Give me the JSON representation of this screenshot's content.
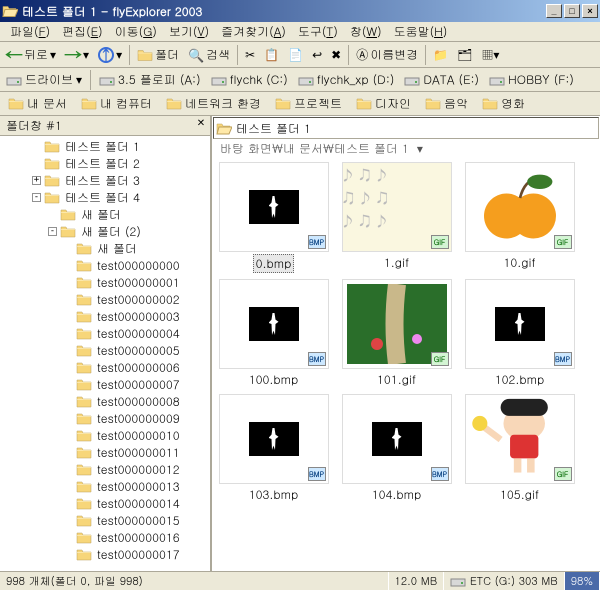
{
  "title": "테스트 폴더 1 - flyExplorer 2003",
  "menu": [
    "파일(F)",
    "편집(E)",
    "이동(G)",
    "보기(V)",
    "즐겨찾기(A)",
    "도구(T)",
    "창(W)",
    "도움말(H)"
  ],
  "tb": {
    "back": "뒤로",
    "folder": "폴더",
    "search": "검색",
    "rename": "이름변경"
  },
  "drives": {
    "label": "드라이브",
    "items": [
      "3.5 플로피 (A:)",
      "flychk (C:)",
      "flychk_xp (D:)",
      "DATA (E:)",
      "HOBBY (F:)"
    ]
  },
  "bookmarks": [
    "내 문서",
    "내 컴퓨터",
    "네트워크 환경",
    "프로젝트",
    "디자인",
    "음악",
    "영화"
  ],
  "treeHeader": "폴더창 #1",
  "tree": [
    {
      "d": 2,
      "e": "",
      "n": "테스트 폴더 1"
    },
    {
      "d": 2,
      "e": "",
      "n": "테스트 폴더 2"
    },
    {
      "d": 2,
      "e": "+",
      "n": "테스트 폴더 3"
    },
    {
      "d": 2,
      "e": "-",
      "n": "테스트 폴더 4"
    },
    {
      "d": 3,
      "e": "",
      "n": "새 폴더"
    },
    {
      "d": 3,
      "e": "-",
      "n": "새 폴더 (2)"
    },
    {
      "d": 4,
      "e": "",
      "n": "새 폴더"
    },
    {
      "d": 4,
      "e": "",
      "n": "test000000000"
    },
    {
      "d": 4,
      "e": "",
      "n": "test000000001"
    },
    {
      "d": 4,
      "e": "",
      "n": "test000000002"
    },
    {
      "d": 4,
      "e": "",
      "n": "test000000003"
    },
    {
      "d": 4,
      "e": "",
      "n": "test000000004"
    },
    {
      "d": 4,
      "e": "",
      "n": "test000000005"
    },
    {
      "d": 4,
      "e": "",
      "n": "test000000006"
    },
    {
      "d": 4,
      "e": "",
      "n": "test000000007"
    },
    {
      "d": 4,
      "e": "",
      "n": "test000000008"
    },
    {
      "d": 4,
      "e": "",
      "n": "test000000009"
    },
    {
      "d": 4,
      "e": "",
      "n": "test000000010"
    },
    {
      "d": 4,
      "e": "",
      "n": "test000000011"
    },
    {
      "d": 4,
      "e": "",
      "n": "test000000012"
    },
    {
      "d": 4,
      "e": "",
      "n": "test000000013"
    },
    {
      "d": 4,
      "e": "",
      "n": "test000000014"
    },
    {
      "d": 4,
      "e": "",
      "n": "test000000015"
    },
    {
      "d": 4,
      "e": "",
      "n": "test000000016"
    },
    {
      "d": 4,
      "e": "",
      "n": "test000000017"
    }
  ],
  "addr": "테스트 폴더 1",
  "breadcrumb": "바탕 화면\\내 문서\\테스트 폴더 1",
  "thumbs": [
    {
      "n": "0.bmp",
      "t": "bmp",
      "p": "sil",
      "sel": true
    },
    {
      "n": "1.gif",
      "t": "gif",
      "p": "notes"
    },
    {
      "n": "10.gif",
      "t": "gif",
      "p": "fruit"
    },
    {
      "n": "100.bmp",
      "t": "bmp",
      "p": "sil"
    },
    {
      "n": "101.gif",
      "t": "gif",
      "p": "garden"
    },
    {
      "n": "102.bmp",
      "t": "bmp",
      "p": "sil"
    },
    {
      "n": "103.bmp",
      "t": "bmp",
      "p": "sil"
    },
    {
      "n": "104.bmp",
      "t": "bmp",
      "p": "sil"
    },
    {
      "n": "105.gif",
      "t": "gif",
      "p": "shin"
    }
  ],
  "status": {
    "left": "998 개체(폴더 0, 파일 998)",
    "size": "12.0 MB",
    "disk": "ETC (G:) 303 MB",
    "pct": "98%"
  }
}
